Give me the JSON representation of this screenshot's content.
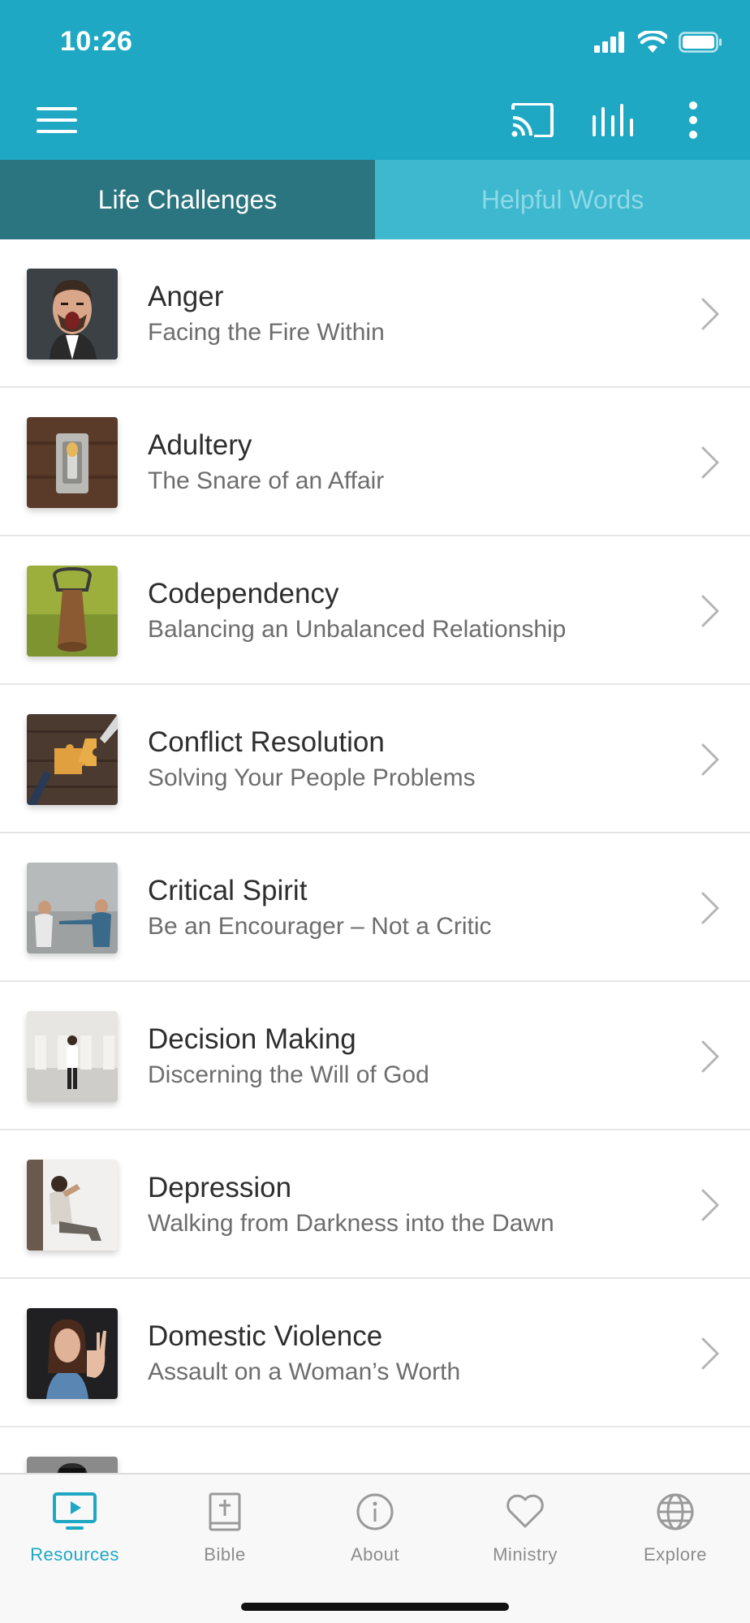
{
  "status_bar": {
    "time": "10:26"
  },
  "colors": {
    "brand": "#1fa8c4",
    "tab_active": "#2a7580",
    "tab_inactive": "#3db8cf"
  },
  "app_bar": {
    "icons": [
      "menu-icon",
      "cast-icon",
      "equalizer-icon",
      "more-vert-icon"
    ]
  },
  "tabs": [
    {
      "label": "Life Challenges",
      "active": true
    },
    {
      "label": "Helpful Words",
      "active": false
    }
  ],
  "items": [
    {
      "title": "Anger",
      "subtitle": "Facing the Fire Within"
    },
    {
      "title": "Adultery",
      "subtitle": "The Snare of an Affair"
    },
    {
      "title": "Codependency",
      "subtitle": "Balancing an Unbalanced Relationship"
    },
    {
      "title": "Conflict Resolution",
      "subtitle": "Solving Your People Problems"
    },
    {
      "title": "Critical Spirit",
      "subtitle": "Be an Encourager – Not a Critic"
    },
    {
      "title": "Decision Making",
      "subtitle": "Discerning the Will of God"
    },
    {
      "title": "Depression",
      "subtitle": "Walking from Darkness into the Dawn"
    },
    {
      "title": "Domestic Violence",
      "subtitle": "Assault on a Woman’s Worth"
    }
  ],
  "bottom_nav": [
    {
      "label": "Resources",
      "icon": "tv-icon",
      "active": true
    },
    {
      "label": "Bible",
      "icon": "bible-icon",
      "active": false
    },
    {
      "label": "About",
      "icon": "info-icon",
      "active": false
    },
    {
      "label": "Ministry",
      "icon": "heart-icon",
      "active": false
    },
    {
      "label": "Explore",
      "icon": "globe-icon",
      "active": false
    }
  ]
}
